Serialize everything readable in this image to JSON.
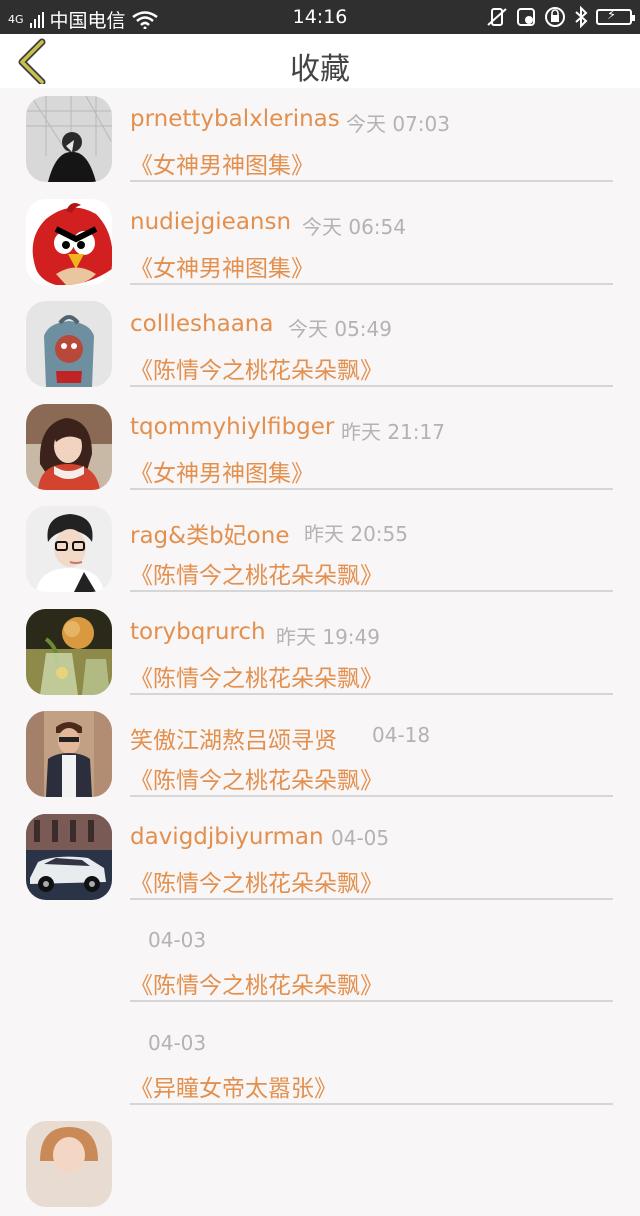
{
  "status_bar": {
    "signal_label": "4G",
    "carrier": "中国电信",
    "time": "14:16"
  },
  "header": {
    "title": "收藏"
  },
  "items": [
    {
      "name": "prnettybalxlerinas",
      "time": "今天 07:03",
      "book": "《女神男神图集》"
    },
    {
      "name": "nudiejgieansn",
      "time": "今天 06:54",
      "book": "《女神男神图集》"
    },
    {
      "name": "collleshaana",
      "time": "今天 05:49",
      "book": "《陈情今之桃花朵朵飘》"
    },
    {
      "name": "tqommyhiylfibger",
      "time": "昨天 21:17",
      "book": "《女神男神图集》"
    },
    {
      "name": "rag&类b妃one",
      "time": "昨天 20:55",
      "book": "《陈情今之桃花朵朵飘》"
    },
    {
      "name": "torybqrurch",
      "time": "昨天 19:49",
      "book": "《陈情今之桃花朵朵飘》"
    },
    {
      "name": "笑傲江湖熬吕颂寻贤",
      "time": "04-18",
      "book": "《陈情今之桃花朵朵飘》"
    },
    {
      "name": "davigdjbiyurman",
      "time": "04-05",
      "book": "《陈情今之桃花朵朵飘》"
    },
    {
      "name": "",
      "time": "04-03",
      "book": "《陈情今之桃花朵朵飘》"
    },
    {
      "name": "",
      "time": "04-03",
      "book": "《异瞳女帝太嚣张》"
    }
  ],
  "colors": {
    "accent": "#e3904f",
    "back_icon": "#c8c24a",
    "status_bar_bg": "#2f2f2f"
  }
}
